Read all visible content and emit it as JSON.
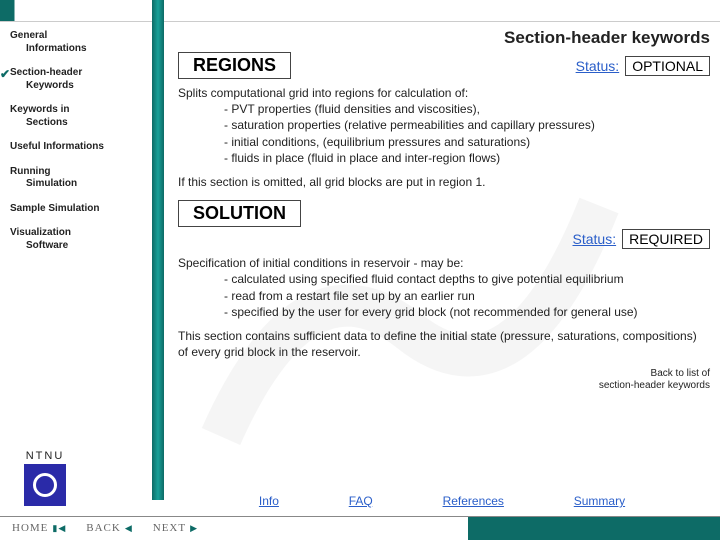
{
  "page": {
    "title": "Section-header keywords"
  },
  "sidebar": {
    "items": [
      {
        "l1": "General",
        "l2": "Informations"
      },
      {
        "l1": "Section-header",
        "l2": "Keywords"
      },
      {
        "l1": "Keywords in",
        "l2": "Sections"
      },
      {
        "l1": "Useful Informations",
        "l2": ""
      },
      {
        "l1": "Running",
        "l2": "Simulation"
      },
      {
        "l1": "Sample Simulation",
        "l2": ""
      },
      {
        "l1": "Visualization",
        "l2": "Software"
      }
    ]
  },
  "block1": {
    "title": "REGIONS",
    "status_label": "Status:",
    "status_value": "OPTIONAL",
    "intro": "Splits computational grid into regions for calculation of:",
    "bullets": [
      "PVT properties (fluid densities and viscosities),",
      "saturation properties (relative permeabilities and  capillary pressures)",
      "initial conditions, (equilibrium pressures and saturations)",
      "fluids in place (fluid in place and inter-region flows)"
    ],
    "footer": "If this section is omitted, all grid blocks are put in region 1."
  },
  "block2": {
    "title": "SOLUTION",
    "status_label": "Status:",
    "status_value": "REQUIRED",
    "intro": "Specification of initial conditions in reservoir - may be:",
    "bullets": [
      "calculated using specified fluid contact depths to give potential equilibrium",
      "read from a restart file set up by an earlier run",
      "specified by the user for every grid block (not recommended for general use)"
    ],
    "footer": "This section contains sufficient data to define the initial state (pressure, saturations, compositions) of every grid block in the reservoir."
  },
  "backlink": {
    "l1": "Back to list of",
    "l2": "section-header keywords"
  },
  "footerlinks": {
    "info": "Info",
    "faq": "FAQ",
    "refs": "References",
    "summary": "Summary"
  },
  "nav": {
    "home": "HOME",
    "back": "BACK",
    "next": "NEXT"
  },
  "logo": {
    "text": "NTNU"
  }
}
